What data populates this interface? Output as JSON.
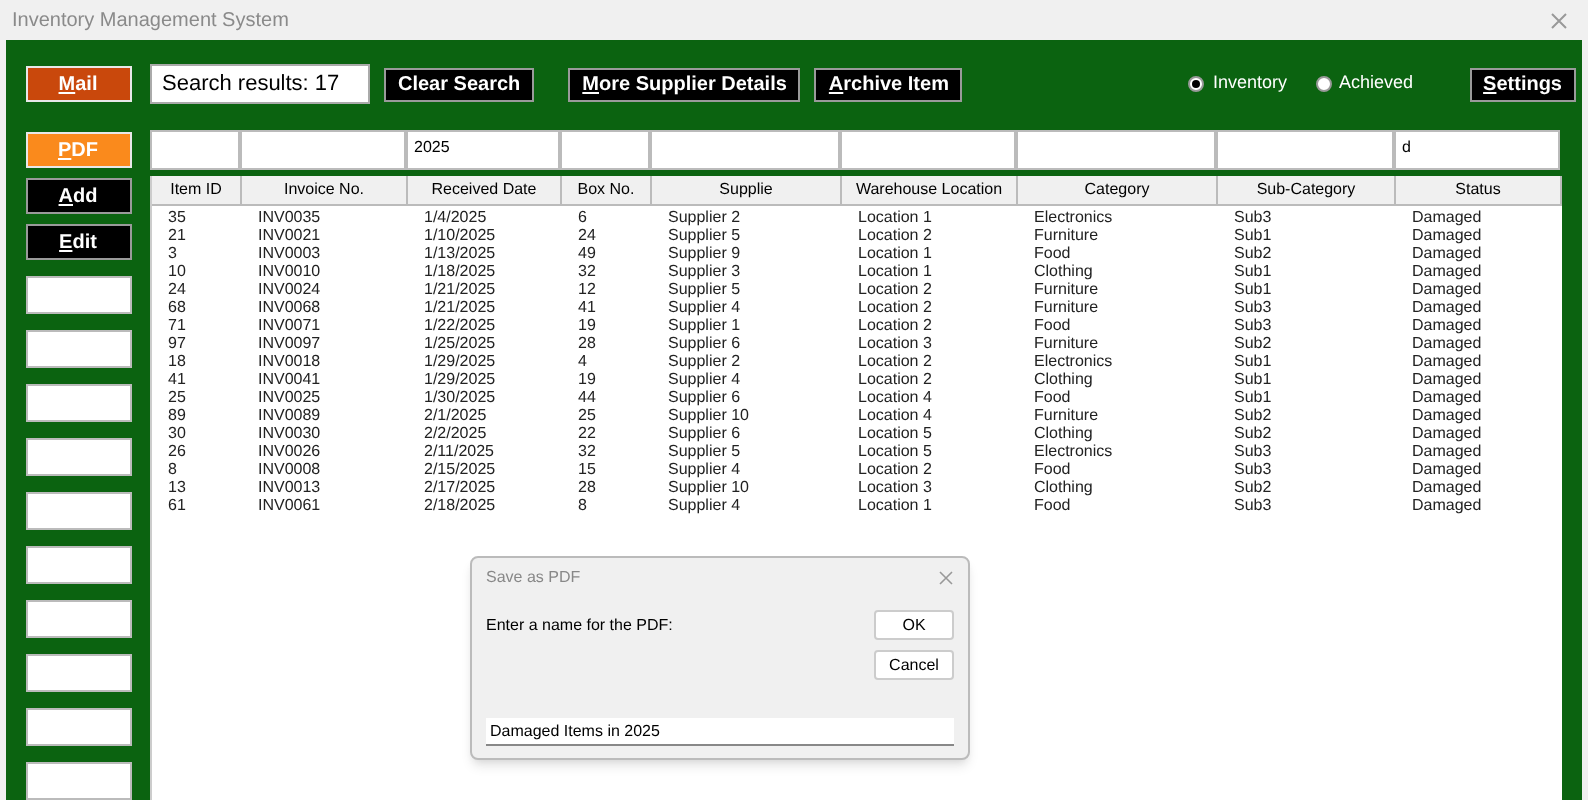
{
  "window": {
    "title": "Inventory Management System"
  },
  "sidebar": {
    "buttons": [
      {
        "label": "Mail",
        "kind": "mail",
        "underline_first": true
      },
      {
        "label": "PDF",
        "kind": "pdf",
        "underline_first": true
      },
      {
        "label": "Add",
        "kind": "dark",
        "underline_first": true
      },
      {
        "label": "Edit",
        "kind": "dark",
        "underline_first": true
      }
    ],
    "empty_fields": [
      {
        "kind": "blank"
      },
      {
        "kind": "blank"
      },
      {
        "kind": "blank"
      },
      {
        "kind": "blank"
      },
      {
        "kind": "blank"
      },
      {
        "kind": "blank"
      },
      {
        "kind": "blank"
      },
      {
        "kind": "blank"
      },
      {
        "kind": "blank"
      },
      {
        "kind": "blank"
      }
    ]
  },
  "toolbar": {
    "search_results": "Search results: 17",
    "buttons": [
      {
        "label": "Clear Search",
        "underline_first": false
      },
      {
        "label": "More Supplier Details",
        "underline_first": true
      },
      {
        "label": "Archive Item",
        "underline_first": true
      }
    ],
    "radios": [
      {
        "label": "Inventory",
        "selected": true
      },
      {
        "label": "Achieved",
        "selected": false
      }
    ],
    "settings": {
      "label": "Settings",
      "underline_first": true
    }
  },
  "filters": [
    {
      "kind": "blank"
    },
    {
      "kind": "blank"
    },
    {
      "kind": "text",
      "value": "2025"
    },
    {
      "kind": "blank"
    },
    {
      "kind": "blank"
    },
    {
      "kind": "blank"
    },
    {
      "kind": "blank"
    },
    {
      "kind": "blank"
    },
    {
      "kind": "text",
      "value": "d"
    }
  ],
  "table": {
    "columns": [
      "Item ID",
      "Invoice No.",
      "Received Date",
      "Box No.",
      "Supplie",
      "Warehouse Location",
      "Category",
      "Sub-Category",
      "Status"
    ],
    "rows": [
      [
        "35",
        "INV0035",
        "1/4/2025",
        "6",
        "Supplier 2",
        "Location 1",
        "Electronics",
        "Sub3",
        "Damaged"
      ],
      [
        "21",
        "INV0021",
        "1/10/2025",
        "24",
        "Supplier 5",
        "Location 2",
        "Furniture",
        "Sub1",
        "Damaged"
      ],
      [
        "3",
        "INV0003",
        "1/13/2025",
        "49",
        "Supplier 9",
        "Location 1",
        "Food",
        "Sub2",
        "Damaged"
      ],
      [
        "10",
        "INV0010",
        "1/18/2025",
        "32",
        "Supplier 3",
        "Location 1",
        "Clothing",
        "Sub1",
        "Damaged"
      ],
      [
        "24",
        "INV0024",
        "1/21/2025",
        "12",
        "Supplier 5",
        "Location 2",
        "Furniture",
        "Sub1",
        "Damaged"
      ],
      [
        "68",
        "INV0068",
        "1/21/2025",
        "41",
        "Supplier 4",
        "Location 2",
        "Furniture",
        "Sub3",
        "Damaged"
      ],
      [
        "71",
        "INV0071",
        "1/22/2025",
        "19",
        "Supplier 1",
        "Location 2",
        "Food",
        "Sub3",
        "Damaged"
      ],
      [
        "97",
        "INV0097",
        "1/25/2025",
        "28",
        "Supplier 6",
        "Location 3",
        "Furniture",
        "Sub2",
        "Damaged"
      ],
      [
        "18",
        "INV0018",
        "1/29/2025",
        "4",
        "Supplier 2",
        "Location 2",
        "Electronics",
        "Sub1",
        "Damaged"
      ],
      [
        "41",
        "INV0041",
        "1/29/2025",
        "19",
        "Supplier 4",
        "Location 2",
        "Clothing",
        "Sub1",
        "Damaged"
      ],
      [
        "25",
        "INV0025",
        "1/30/2025",
        "44",
        "Supplier 6",
        "Location 4",
        "Food",
        "Sub1",
        "Damaged"
      ],
      [
        "89",
        "INV0089",
        "2/1/2025",
        "25",
        "Supplier 10",
        "Location 4",
        "Furniture",
        "Sub2",
        "Damaged"
      ],
      [
        "30",
        "INV0030",
        "2/2/2025",
        "22",
        "Supplier 6",
        "Location 5",
        "Clothing",
        "Sub2",
        "Damaged"
      ],
      [
        "26",
        "INV0026",
        "2/11/2025",
        "32",
        "Supplier 5",
        "Location 5",
        "Electronics",
        "Sub3",
        "Damaged"
      ],
      [
        "8",
        "INV0008",
        "2/15/2025",
        "15",
        "Supplier 4",
        "Location 2",
        "Food",
        "Sub3",
        "Damaged"
      ],
      [
        "13",
        "INV0013",
        "2/17/2025",
        "28",
        "Supplier 10",
        "Location 3",
        "Clothing",
        "Sub2",
        "Damaged"
      ],
      [
        "61",
        "INV0061",
        "2/18/2025",
        "8",
        "Supplier 4",
        "Location 1",
        "Food",
        "Sub3",
        "Damaged"
      ]
    ]
  },
  "dialog": {
    "title": "Save as PDF",
    "prompt": "Enter a name for the PDF:",
    "buttons": [
      "OK",
      "Cancel"
    ],
    "value": "Damaged Items in 2025"
  }
}
